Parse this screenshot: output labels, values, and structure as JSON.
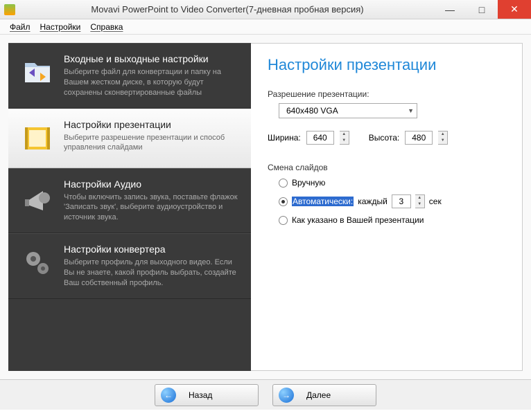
{
  "window": {
    "title": "Movavi PowerPoint to Video Converter(7-дневная пробная версия)"
  },
  "menu": {
    "file": "Файл",
    "settings": "Настройки",
    "help": "Справка"
  },
  "sidebar": {
    "items": [
      {
        "title": "Входные и выходные настройки",
        "desc": "Выберите файл для конвертации и папку на Вашем жестком диске, в которую будут сохранены сконвертированные файлы"
      },
      {
        "title": "Настройки презентации",
        "desc": "Выберите разрешение презентации и способ управления слайдами"
      },
      {
        "title": "Настройки Аудио",
        "desc": "Чтобы включить запись звука, поставьте флажок 'Записать звук', выберите аудиоустройство и источник звука."
      },
      {
        "title": "Настройки конвертера",
        "desc": "Выберите профиль для выходного видео. Если Вы не знаете, какой профиль выбрать, создайте Ваш собственный профиль."
      }
    ]
  },
  "panel": {
    "heading": "Настройки презентации",
    "resolution_label": "Разрешение презентации:",
    "resolution_value": "640x480 VGA",
    "width_label": "Ширина:",
    "width_value": "640",
    "height_label": "Высота:",
    "height_value": "480",
    "slidechange_label": "Смена слайдов",
    "radio_manual": "Вручную",
    "radio_auto": "Автоматически:",
    "auto_every": "каждый",
    "auto_value": "3",
    "auto_sec": "сек",
    "radio_aspres": "Как указано в Вашей презентации"
  },
  "footer": {
    "back": "Назад",
    "next": "Далее"
  }
}
